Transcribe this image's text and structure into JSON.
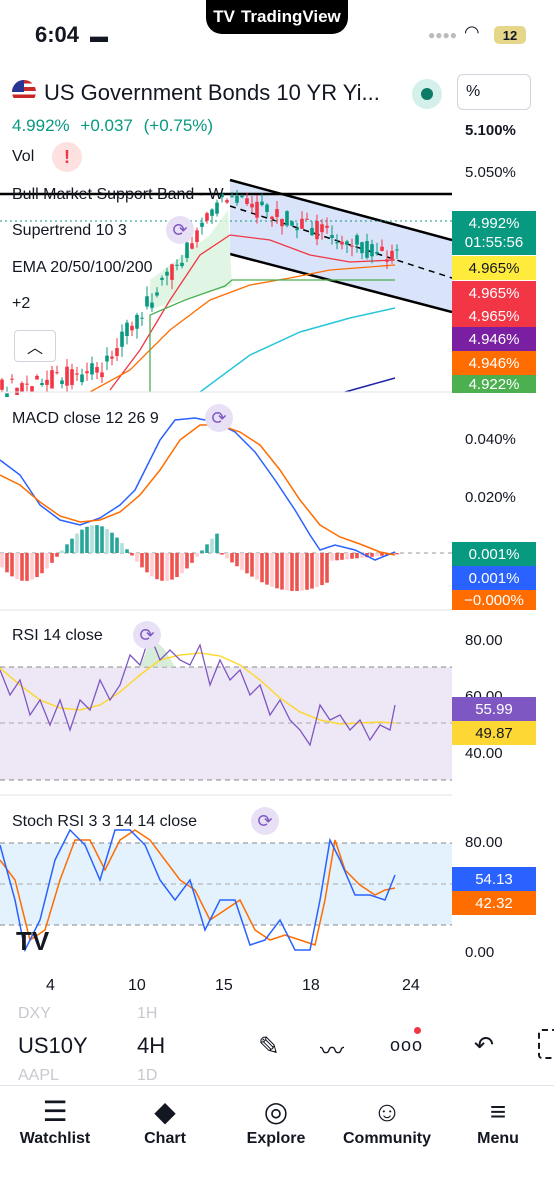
{
  "status_bar": {
    "time": "6:04",
    "app_pill": "TradingView",
    "battery": "12"
  },
  "header": {
    "title": "US Government Bonds 10 YR Yi...",
    "price": "4.992%",
    "change": "+0.037",
    "change_pct": "(+0.75%)",
    "unit_button": "%"
  },
  "main_pane": {
    "indicators": [
      "Vol",
      "Bull Market Support Band · W",
      "Supertrend 10 3",
      "EMA 20/50/100/200",
      "+2"
    ],
    "axis_labels": [
      "5.100%",
      "5.050%"
    ],
    "tags": [
      {
        "text": "4.992%",
        "sub": "01:55:56",
        "color": "#089981"
      },
      {
        "text": "4.965%",
        "color": "#ffeb3b",
        "dark": true
      },
      {
        "text": "4.965%",
        "color": "#f23645"
      },
      {
        "text": "4.965%",
        "color": "#f23645"
      },
      {
        "text": "4.946%",
        "color": "#7b1fa2"
      },
      {
        "text": "4.946%",
        "color": "#ff6d00"
      },
      {
        "text": "4.922%",
        "color": "#4caf50"
      }
    ]
  },
  "macd_pane": {
    "label": "MACD close 12 26 9",
    "axis_labels": [
      "0.040%",
      "0.020%"
    ],
    "tags": [
      {
        "text": "0.001%",
        "color": "#089981"
      },
      {
        "text": "0.001%",
        "color": "#2962ff"
      },
      {
        "text": "−0.000%",
        "color": "#ff6d00"
      }
    ]
  },
  "rsi_pane": {
    "label": "RSI 14 close",
    "axis_labels": [
      "80.00",
      "60.00",
      "40.00"
    ],
    "tags": [
      {
        "text": "55.99",
        "color": "#7e57c2"
      },
      {
        "text": "49.87",
        "color": "#fdd835",
        "dark": true
      }
    ]
  },
  "stoch_pane": {
    "label": "Stoch RSI 3 3 14 14 close",
    "axis_labels": [
      "80.00",
      "0.00"
    ],
    "tags": [
      {
        "text": "54.13",
        "color": "#2962ff"
      },
      {
        "text": "42.32",
        "color": "#ff6d00"
      }
    ]
  },
  "time_axis": [
    "4",
    "10",
    "15",
    "18",
    "24"
  ],
  "symbol_bar": {
    "prev_symbol": "DXY",
    "prev_interval": "1H",
    "symbol": "US10Y",
    "interval": "4H",
    "next_symbol": "AAPL",
    "next_interval": "1D"
  },
  "tabs": [
    "Watchlist",
    "Chart",
    "Explore",
    "Community",
    "Menu"
  ]
}
